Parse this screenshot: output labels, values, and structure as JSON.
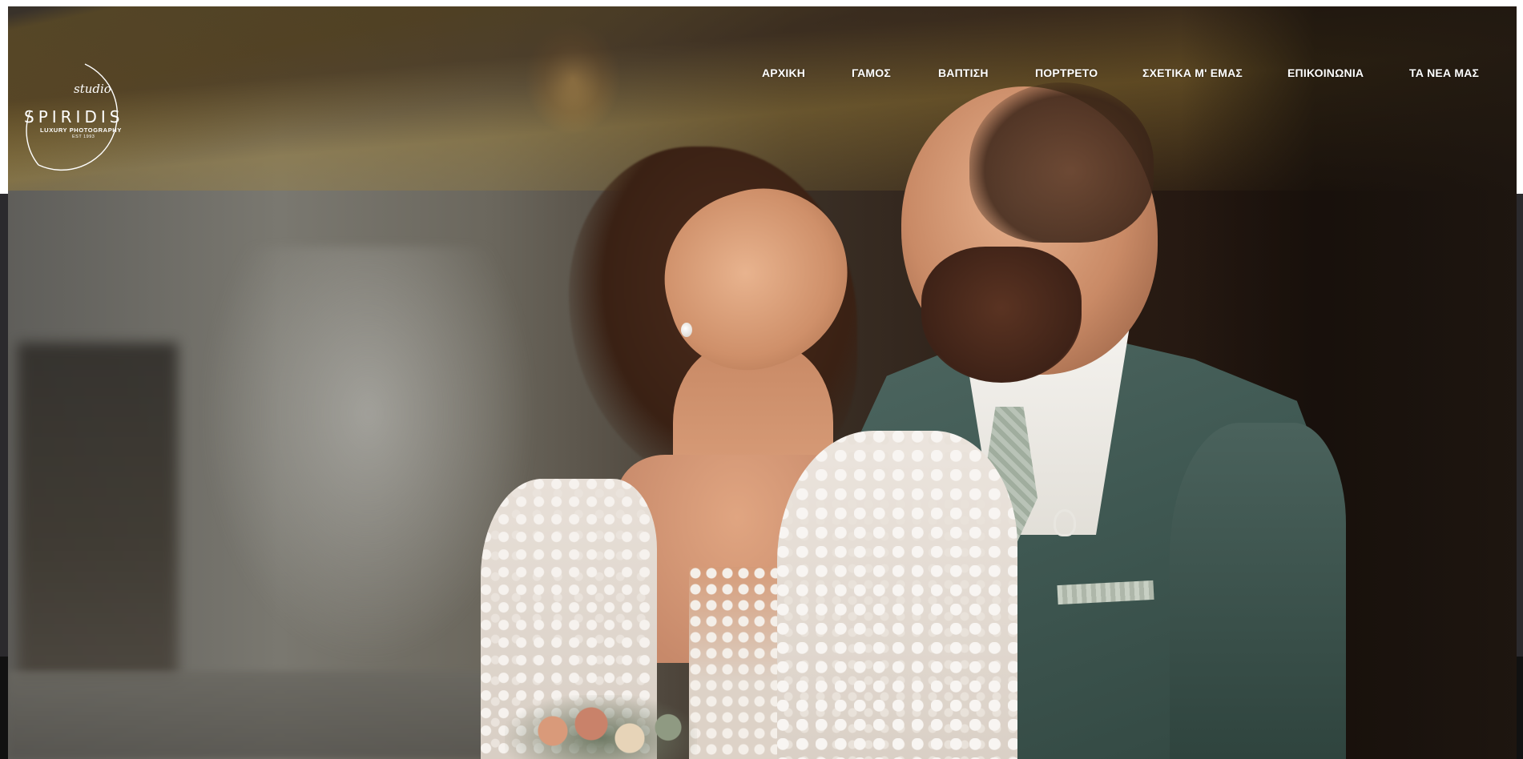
{
  "site": {
    "logo": {
      "script_text": "studio",
      "brand_text": "SPIRIDIS",
      "tagline": "LUXURY PHOTOGRAPHY",
      "established": "EST 1993"
    },
    "nav": {
      "items": [
        {
          "label": "ΑΡΧΙΚΗ"
        },
        {
          "label": "ΓΑΜΟΣ"
        },
        {
          "label": "ΒΑΠΤΙΣΗ"
        },
        {
          "label": "ΠΟΡΤΡΕΤΟ"
        },
        {
          "label": "ΣΧΕΤΙΚΑ Μ' ΕΜΑΣ"
        },
        {
          "label": "ΕΠΙΚΟΙΝΩΝΙΑ"
        },
        {
          "label": "ΤΑ ΝΕΑ ΜΑΣ"
        }
      ]
    }
  },
  "hero": {
    "image_subject": "wedding-couple-photo"
  },
  "colors": {
    "nav_text": "#ffffff",
    "side_strip": "#2b2a2d",
    "page_background": "#ffffff"
  }
}
